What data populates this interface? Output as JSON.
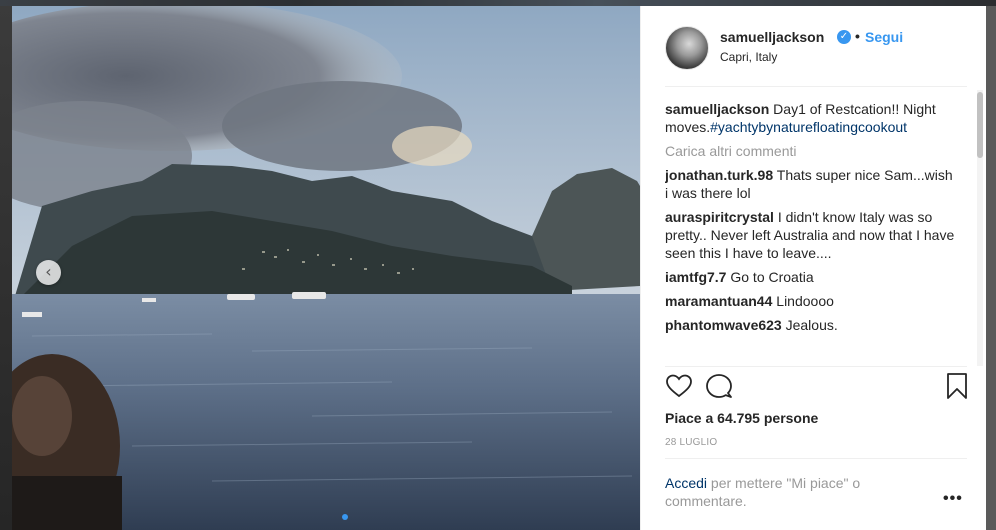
{
  "post": {
    "username": "samuelljackson",
    "separator": "•",
    "follow_label": "Segui",
    "location": "Capri, Italy",
    "verified_icon": "verified-badge-icon"
  },
  "caption": {
    "user": "samuelljackson",
    "text_line1": " Day1 of Restcation!! Night",
    "text_line2": "moves.",
    "hashtag": "#yachtybynaturefloatingcookout"
  },
  "load_more_label": "Carica altri commenti",
  "comments": [
    {
      "user": "jonathan.turk.98",
      "text": " Thats super nice Sam...wish i was there lol"
    },
    {
      "user": "auraspiritcrystal",
      "text": " I didn't know Italy was so pretty.. Never left Australia and now that I have seen this I have to leave...."
    },
    {
      "user": "iamtfg7.7",
      "text": " Go to Croatia"
    },
    {
      "user": "maramantuan44",
      "text": " Lindoooo"
    },
    {
      "user": "phantomwave623",
      "text": " Jealous."
    }
  ],
  "actions": {
    "like_icon": "heart-icon",
    "comment_icon": "comment-icon",
    "save_icon": "bookmark-icon"
  },
  "likes_text": "Piace a 64.795 persone",
  "date": "28 LUGLIO",
  "login": {
    "link": "Accedi",
    "text": " per mettere \"Mi piace\" o commentare."
  },
  "more_label": "•••",
  "nav": {
    "prev_label": "‹"
  },
  "colors": {
    "accent": "#3897f0",
    "text": "#262626",
    "muted": "#999999",
    "link": "#003569"
  }
}
